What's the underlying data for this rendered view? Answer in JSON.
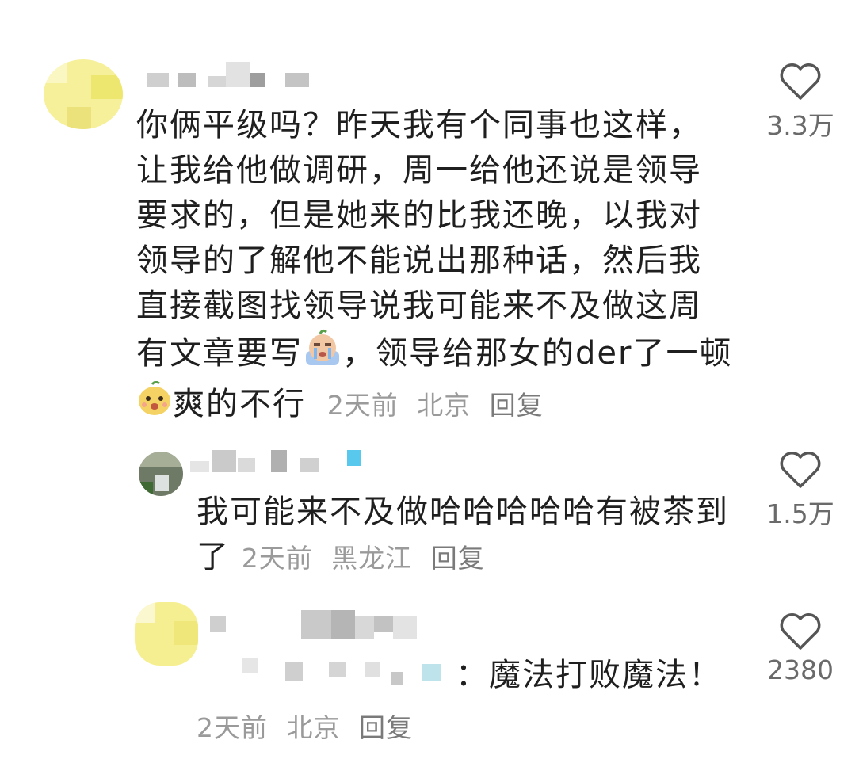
{
  "comments": [
    {
      "text_lines": [
        "你俩平级吗？昨天我有个同事也这样，",
        "让我给他做调研，周一给他还说是领导",
        "要求的，但是她来的比我还晚，以我对",
        "领导的了解他不能说出那种话，然后我",
        "直接截图找领导说我可能来不及做这周"
      ],
      "line6_before": "有文章要写",
      "line6_after": "，领导给那女的der了一顿",
      "line7": "爽的不行",
      "emoji1": "crying-face-emoji",
      "emoji2": "smiling-face-emoji",
      "time": "2天前",
      "location": "北京",
      "reply": "回复",
      "likes": "3.3万"
    },
    {
      "text_lines": [
        "我可能来不及做哈哈哈哈哈有被茶到"
      ],
      "last_line": "了",
      "time": "2天前",
      "location": "黑龙江",
      "reply": "回复",
      "likes": "1.5万"
    },
    {
      "text": "：魔法打败魔法！",
      "time": "2天前",
      "location": "北京",
      "reply": "回复",
      "likes": "2380"
    }
  ],
  "icons": {
    "like": "heart-outline-icon"
  },
  "colors": {
    "text": "#1f1f1f",
    "meta": "#9a9a9a",
    "count": "#6a6a6a"
  }
}
